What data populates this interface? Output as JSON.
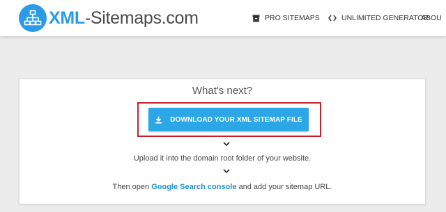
{
  "header": {
    "logo": {
      "xml": "XML",
      "rest": "-Sitemaps.com"
    },
    "nav": {
      "pro_sitemaps": "PRO SITEMAPS",
      "unlimited_generator": "UNLIMITED GENERATOR",
      "about": "ABOU"
    }
  },
  "main": {
    "heading": "What's next?",
    "download_button": "DOWNLOAD YOUR XML SITEMAP FILE",
    "step1": "Upload it into the domain root folder of your website.",
    "step2": {
      "before": "Then open ",
      "link": "Google Search console",
      "after": " and add your sitemap URL."
    }
  },
  "colors": {
    "accent_blue": "#2ba7e7",
    "link_blue": "#1e8fd6",
    "highlight_red": "#c8202a",
    "logo_blue": "#2b9be8"
  },
  "icons": [
    "sitemap-logo-icon",
    "box-icon",
    "code-icon",
    "download-icon",
    "chevron-down-icon"
  ]
}
